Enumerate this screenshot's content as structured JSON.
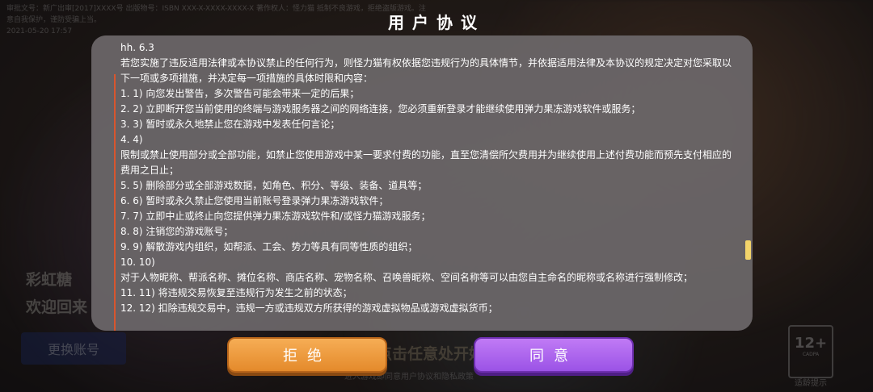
{
  "background": {
    "top_info": "审批文号：新广出审[2017]XXXX号 出版物号：ISBN XXX-X-XXXX-XXXX-X 著作权人：怪力猫 抵制不良游戏，拒绝盗版游戏。注意自我保护，谨防受骗上当。",
    "top_info2": "2021-05-20 17:57",
    "player_name": "彩虹糖",
    "welcome": "欢迎回来",
    "switch_account": "更换账号",
    "start_game": "点击任意处开始游戏",
    "sub_note": "进入游戏即同意用户协议和隐私政策",
    "age_rating": "12+",
    "age_rating_sub": "CADPA",
    "age_label": "适龄提示"
  },
  "dialog": {
    "title": "用户协议",
    "lines": [
      "hh. 6.3",
      "若您实施了违反适用法律或本协议禁止的任何行为，则怪力猫有权依据您违规行为的具体情节，并依据适用法律及本协议的规定决定对您采取以下一项或多项措施，并决定每一项措施的具体时限和内容：",
      "1. 1) 向您发出警告，多次警告可能会带来一定的后果；",
      "2. 2) 立即断开您当前使用的终端与游戏服务器之间的网络连接，您必须重新登录才能继续使用弹力果冻游戏软件或服务；",
      "3. 3) 暂时或永久地禁止您在游戏中发表任何言论；",
      "4. 4)",
      "限制或禁止使用部分或全部功能，如禁止您使用游戏中某一要求付费的功能，直至您清偿所欠费用并为继续使用上述付费功能而预先支付相应的费用之日止；",
      "5. 5) 删除部分或全部游戏数据，如角色、积分、等级、装备、道具等；",
      "6. 6) 暂时或永久禁止您使用当前账号登录弹力果冻游戏软件；",
      "7. 7) 立即中止或终止向您提供弹力果冻游戏软件和/或怪力猫游戏服务；",
      "8. 8) 注销您的游戏账号；",
      "9. 9) 解散游戏内组织，如帮派、工会、势力等具有同等性质的组织；",
      "10. 10)",
      "对于人物昵称、帮派名称、摊位名称、商店名称、宠物名称、召唤兽昵称、空间名称等可以由您自主命名的昵称或名称进行强制修改；",
      "11. 11) 将违规交易恢复至违规行为发生之前的状态；",
      "12. 12) 扣除违规交易中，违规一方或违规双方所获得的游戏虚拟物品或游戏虚拟货币；"
    ],
    "reject_label": "拒绝",
    "agree_label": "同意"
  },
  "colors": {
    "reject": "#f0a040",
    "agree": "#b06cf0",
    "rule": "#d8562e",
    "scroll_thumb": "#f3d46a"
  },
  "scroll": {
    "position_fraction": 0.78
  }
}
